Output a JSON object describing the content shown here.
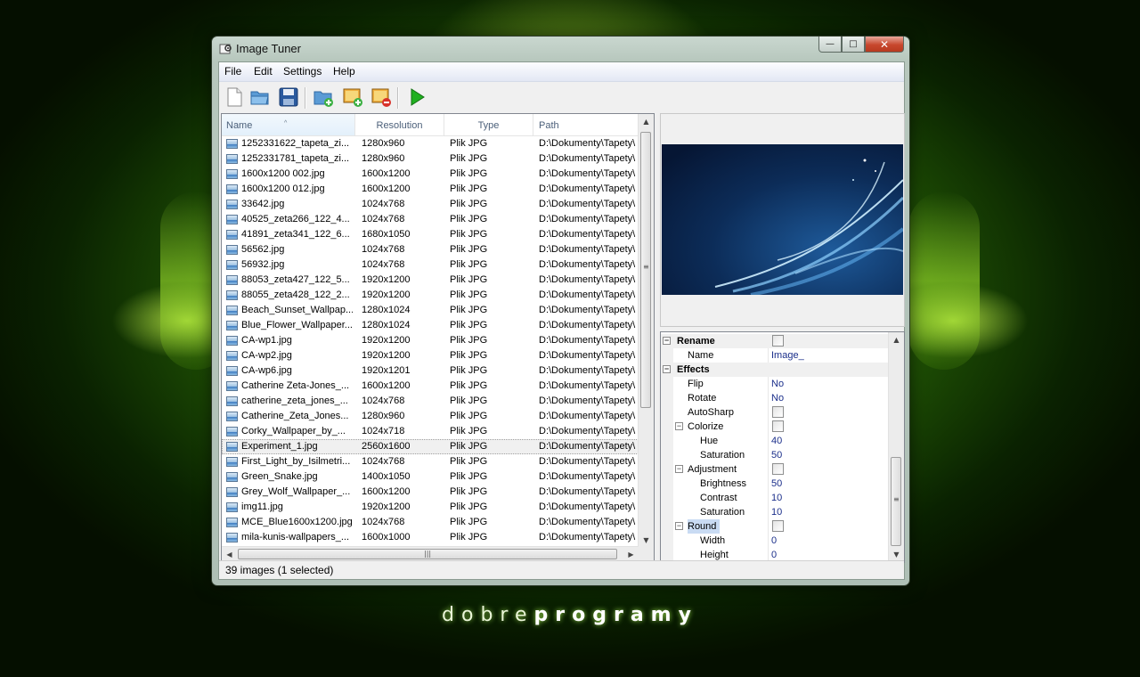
{
  "window": {
    "title": "Image Tuner",
    "minimize": "—",
    "maximize": "□",
    "close": "✕"
  },
  "menu": [
    "File",
    "Edit",
    "Settings",
    "Help"
  ],
  "toolbar": {
    "icons": [
      "new-file-icon",
      "open-folder-icon",
      "save-icon",
      "add-folder-icon",
      "add-image-icon",
      "remove-image-icon",
      "run-icon"
    ],
    "run_color": "#20b020"
  },
  "list": {
    "columns": {
      "name": "Name",
      "resolution": "Resolution",
      "type": "Type",
      "path": "Path"
    },
    "sort_indicator": "^",
    "rows": [
      {
        "name": "1252331622_tapeta_zi...",
        "res": "1280x960",
        "type": "Plik JPG",
        "path": "D:\\Dokumenty\\Tapety\\"
      },
      {
        "name": "1252331781_tapeta_zi...",
        "res": "1280x960",
        "type": "Plik JPG",
        "path": "D:\\Dokumenty\\Tapety\\"
      },
      {
        "name": "1600x1200 002.jpg",
        "res": "1600x1200",
        "type": "Plik JPG",
        "path": "D:\\Dokumenty\\Tapety\\"
      },
      {
        "name": "1600x1200 012.jpg",
        "res": "1600x1200",
        "type": "Plik JPG",
        "path": "D:\\Dokumenty\\Tapety\\"
      },
      {
        "name": "33642.jpg",
        "res": "1024x768",
        "type": "Plik JPG",
        "path": "D:\\Dokumenty\\Tapety\\"
      },
      {
        "name": "40525_zeta266_122_4...",
        "res": "1024x768",
        "type": "Plik JPG",
        "path": "D:\\Dokumenty\\Tapety\\"
      },
      {
        "name": "41891_zeta341_122_6...",
        "res": "1680x1050",
        "type": "Plik JPG",
        "path": "D:\\Dokumenty\\Tapety\\"
      },
      {
        "name": "56562.jpg",
        "res": "1024x768",
        "type": "Plik JPG",
        "path": "D:\\Dokumenty\\Tapety\\"
      },
      {
        "name": "56932.jpg",
        "res": "1024x768",
        "type": "Plik JPG",
        "path": "D:\\Dokumenty\\Tapety\\"
      },
      {
        "name": "88053_zeta427_122_5...",
        "res": "1920x1200",
        "type": "Plik JPG",
        "path": "D:\\Dokumenty\\Tapety\\"
      },
      {
        "name": "88055_zeta428_122_2...",
        "res": "1920x1200",
        "type": "Plik JPG",
        "path": "D:\\Dokumenty\\Tapety\\"
      },
      {
        "name": "Beach_Sunset_Wallpap...",
        "res": "1280x1024",
        "type": "Plik JPG",
        "path": "D:\\Dokumenty\\Tapety\\"
      },
      {
        "name": "Blue_Flower_Wallpaper...",
        "res": "1280x1024",
        "type": "Plik JPG",
        "path": "D:\\Dokumenty\\Tapety\\"
      },
      {
        "name": "CA-wp1.jpg",
        "res": "1920x1200",
        "type": "Plik JPG",
        "path": "D:\\Dokumenty\\Tapety\\"
      },
      {
        "name": "CA-wp2.jpg",
        "res": "1920x1200",
        "type": "Plik JPG",
        "path": "D:\\Dokumenty\\Tapety\\"
      },
      {
        "name": "CA-wp6.jpg",
        "res": "1920x1201",
        "type": "Plik JPG",
        "path": "D:\\Dokumenty\\Tapety\\"
      },
      {
        "name": "Catherine Zeta-Jones_...",
        "res": "1600x1200",
        "type": "Plik JPG",
        "path": "D:\\Dokumenty\\Tapety\\"
      },
      {
        "name": "catherine_zeta_jones_...",
        "res": "1024x768",
        "type": "Plik JPG",
        "path": "D:\\Dokumenty\\Tapety\\"
      },
      {
        "name": "Catherine_Zeta_Jones...",
        "res": "1280x960",
        "type": "Plik JPG",
        "path": "D:\\Dokumenty\\Tapety\\"
      },
      {
        "name": "Corky_Wallpaper_by_...",
        "res": "1024x718",
        "type": "Plik JPG",
        "path": "D:\\Dokumenty\\Tapety\\"
      },
      {
        "name": "Experiment_1.jpg",
        "res": "2560x1600",
        "type": "Plik JPG",
        "path": "D:\\Dokumenty\\Tapety\\",
        "selected": true
      },
      {
        "name": "First_Light_by_Isilmetri...",
        "res": "1024x768",
        "type": "Plik JPG",
        "path": "D:\\Dokumenty\\Tapety\\"
      },
      {
        "name": "Green_Snake.jpg",
        "res": "1400x1050",
        "type": "Plik JPG",
        "path": "D:\\Dokumenty\\Tapety\\"
      },
      {
        "name": "Grey_Wolf_Wallpaper_...",
        "res": "1600x1200",
        "type": "Plik JPG",
        "path": "D:\\Dokumenty\\Tapety\\"
      },
      {
        "name": "img11.jpg",
        "res": "1920x1200",
        "type": "Plik JPG",
        "path": "D:\\Dokumenty\\Tapety\\"
      },
      {
        "name": "MCE_Blue1600x1200.jpg",
        "res": "1024x768",
        "type": "Plik JPG",
        "path": "D:\\Dokumenty\\Tapety\\"
      },
      {
        "name": "mila-kunis-wallpapers_...",
        "res": "1600x1000",
        "type": "Plik JPG",
        "path": "D:\\Dokumenty\\Tapety\\"
      }
    ]
  },
  "properties": [
    {
      "type": "category",
      "label": "Rename",
      "expander": "−",
      "checkbox": true
    },
    {
      "type": "item",
      "label": "Name",
      "value": "Image_"
    },
    {
      "type": "category",
      "label": "Effects",
      "expander": "−"
    },
    {
      "type": "item",
      "label": "Flip",
      "value": "No"
    },
    {
      "type": "item",
      "label": "Rotate",
      "value": "No"
    },
    {
      "type": "item",
      "label": "AutoSharp",
      "checkbox": true
    },
    {
      "type": "group",
      "label": "Colorize",
      "expander": "−",
      "checkbox": true
    },
    {
      "type": "sub",
      "label": "Hue",
      "value": "40"
    },
    {
      "type": "sub",
      "label": "Saturation",
      "value": "50"
    },
    {
      "type": "group",
      "label": "Adjustment",
      "expander": "−",
      "checkbox": true
    },
    {
      "type": "sub",
      "label": "Brightness",
      "value": "50"
    },
    {
      "type": "sub",
      "label": "Contrast",
      "value": "10"
    },
    {
      "type": "sub",
      "label": "Saturation",
      "value": "10"
    },
    {
      "type": "group",
      "label": "Round",
      "expander": "−",
      "checkbox": true,
      "highlight": true
    },
    {
      "type": "sub",
      "label": "Width",
      "value": "0"
    },
    {
      "type": "sub",
      "label": "Height",
      "value": "0"
    }
  ],
  "status": "39 images (1 selected)",
  "brand": {
    "light": "dobre",
    "bold": "programy"
  }
}
